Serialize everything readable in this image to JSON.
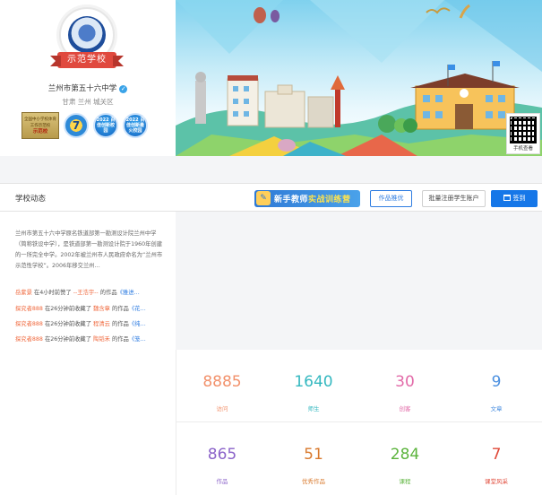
{
  "profile": {
    "badge_text": "示范学校",
    "school_name": "兰州市第五十六中学",
    "location": "甘肃 兰州 城关区",
    "plaque_title": "全国中小学校体育工作示范校",
    "plaque_emphasis": "示范校",
    "medal_seven": "7",
    "medal_1_text": "2022 百佳创新校园",
    "medal_2_text": "2022 百佳创新最火校园"
  },
  "banner": {
    "qr_label": "手机查看"
  },
  "toolbar": {
    "title": "学校动态",
    "trainee_prefix": "新手教师",
    "trainee_highlight": "实战训练营",
    "works_button": "作品推优",
    "register_button": "批量注册学生账户",
    "signin_button": "签到"
  },
  "intro_text": "兰州市第五十六中学原名铁道部第一勘测设计院兰州中学（简称铁设中学），是铁道部第一勘测设计院于1960年创建的一所完全中学。2002年被兰州市人民政府命名为“兰州市示范性学校”。2006年移交兰州…",
  "activities": [
    {
      "user": "岳紫景",
      "action": "在4小时前赞了",
      "name": "--王浩宇--",
      "mid": "的作品",
      "work": "《雅进…"
    },
    {
      "user": "探究者888",
      "action": "在26分钟前收藏了",
      "name": "魏含章",
      "mid": "的作品",
      "work": "《花…"
    },
    {
      "user": "探究者888",
      "action": "在26分钟前收藏了",
      "name": "程清云",
      "mid": "的作品",
      "work": "《纯…"
    },
    {
      "user": "探究者888",
      "action": "在26分钟前收藏了",
      "name": "陶韬禾",
      "mid": "的作品",
      "work": "《笼…"
    }
  ],
  "stats": [
    {
      "value": "8885",
      "label": "访问",
      "color": "#f2916b"
    },
    {
      "value": "1640",
      "label": "师生",
      "color": "#34b8c0"
    },
    {
      "value": "30",
      "label": "创客",
      "color": "#e26aa8"
    },
    {
      "value": "9",
      "label": "文章",
      "color": "#4a8fe0"
    },
    {
      "value": "865",
      "label": "作品",
      "color": "#8b63c9"
    },
    {
      "value": "51",
      "label": "优秀作品",
      "color": "#d97a2e"
    },
    {
      "value": "284",
      "label": "课程",
      "color": "#5cb43d"
    },
    {
      "value": "7",
      "label": "课堂风采",
      "color": "#e04a3a"
    }
  ]
}
